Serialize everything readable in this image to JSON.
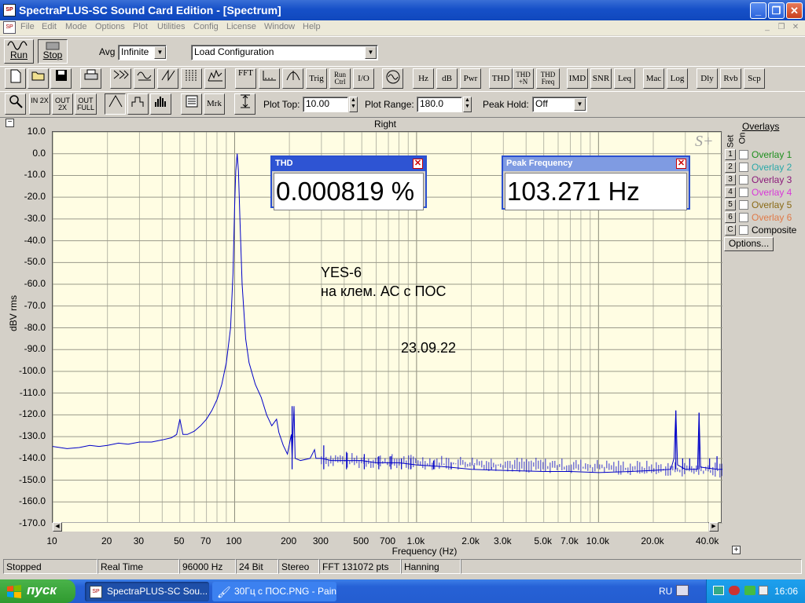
{
  "window": {
    "title": "SpectraPLUS-SC Sound Card Edition - [Spectrum]",
    "app_icon": "spectraplus-icon"
  },
  "menu": [
    "File",
    "Edit",
    "Mode",
    "Options",
    "Plot",
    "Utilities",
    "Config",
    "License",
    "Window",
    "Help"
  ],
  "toolbar1": {
    "run_label": "Run",
    "stop_label": "Stop",
    "avg_label": "Avg",
    "avg_value": "Infinite",
    "config_value": "Load Configuration"
  },
  "toolbar2": {
    "icon_buttons": [
      "new-file-icon",
      "open-folder-icon",
      "save-disk-icon",
      "print-icon"
    ],
    "buttons": [
      "FFT",
      "Trig",
      "Run Ctrl",
      "I/O",
      "Hz",
      "dB",
      "Pwr",
      "THD",
      "THD +N",
      "THD Freq",
      "IMD",
      "SNR",
      "Leq",
      "Mac",
      "Log",
      "Dly",
      "Rvb",
      "Scp"
    ]
  },
  "toolbar3": {
    "zoom_buttons": [
      "IN 2X",
      "OUT 2X",
      "OUT FULL"
    ],
    "mrk_label": "Mrk",
    "plot_top_label": "Plot Top:",
    "plot_top_value": "10.00",
    "plot_range_label": "Plot Range:",
    "plot_range_value": "180.0",
    "peak_hold_label": "Peak Hold:",
    "peak_hold_value": "Off"
  },
  "plot": {
    "channel_title": "Right",
    "ylabel": "dBV rms",
    "xlabel": "Frequency (Hz)",
    "annotation_line1": "YES-6",
    "annotation_line2": "на клем. АС с ПОС",
    "annotation_date": "23.09.22",
    "trace_color": "#0000c8",
    "background_color": "#fffde3"
  },
  "chart_data": {
    "type": "line",
    "title": "Right",
    "xlabel": "Frequency (Hz)",
    "ylabel": "dBV rms",
    "x_scale": "log",
    "xlim": [
      10,
      48000
    ],
    "ylim": [
      -170,
      10
    ],
    "grid": true,
    "y_ticks": [
      "10.0",
      "0.0",
      "-10.0",
      "-20.0",
      "-30.0",
      "-40.0",
      "-50.0",
      "-60.0",
      "-70.0",
      "-80.0",
      "-90.0",
      "-100.0",
      "-110.0",
      "-120.0",
      "-130.0",
      "-140.0",
      "-150.0",
      "-160.0",
      "-170.0"
    ],
    "x_ticks": [
      {
        "v": 10,
        "t": "10"
      },
      {
        "v": 20,
        "t": "20"
      },
      {
        "v": 30,
        "t": "30"
      },
      {
        "v": 50,
        "t": "50"
      },
      {
        "v": 70,
        "t": "70"
      },
      {
        "v": 100,
        "t": "100"
      },
      {
        "v": 200,
        "t": "200"
      },
      {
        "v": 300,
        "t": "300"
      },
      {
        "v": 500,
        "t": "500"
      },
      {
        "v": 700,
        "t": "700"
      },
      {
        "v": 1000,
        "t": "1.0k"
      },
      {
        "v": 2000,
        "t": "2.0k"
      },
      {
        "v": 3000,
        "t": "3.0k"
      },
      {
        "v": 5000,
        "t": "5.0k"
      },
      {
        "v": 7000,
        "t": "7.0k"
      },
      {
        "v": 10000,
        "t": "10.0k"
      },
      {
        "v": 20000,
        "t": "20.0k"
      },
      {
        "v": 40000,
        "t": "40.0k"
      }
    ],
    "series": [
      {
        "color": "#0000c8",
        "points": [
          [
            10,
            -134.5
          ],
          [
            12,
            -135.5
          ],
          [
            14,
            -135
          ],
          [
            16,
            -134
          ],
          [
            18,
            -134.5
          ],
          [
            20,
            -134
          ],
          [
            23,
            -133
          ],
          [
            26,
            -133.5
          ],
          [
            30,
            -132.5
          ],
          [
            35,
            -132.5
          ],
          [
            40,
            -131.5
          ],
          [
            45,
            -130.5
          ],
          [
            48,
            -129
          ],
          [
            50,
            -122
          ],
          [
            52,
            -129
          ],
          [
            55,
            -129
          ],
          [
            60,
            -127.5
          ],
          [
            65,
            -125
          ],
          [
            70,
            -122
          ],
          [
            75,
            -118
          ],
          [
            80,
            -113
          ],
          [
            85,
            -106
          ],
          [
            90,
            -96
          ],
          [
            95,
            -80
          ],
          [
            98,
            -55
          ],
          [
            100,
            -25
          ],
          [
            101.5,
            -8
          ],
          [
            103.27,
            0
          ],
          [
            105,
            -8
          ],
          [
            107,
            -30
          ],
          [
            110,
            -60
          ],
          [
            115,
            -85
          ],
          [
            120,
            -96
          ],
          [
            130,
            -106
          ],
          [
            140,
            -112
          ],
          [
            150,
            -120
          ],
          [
            160,
            -125
          ],
          [
            170,
            -122
          ],
          [
            175,
            -128
          ],
          [
            185,
            -134
          ],
          [
            195,
            -138
          ],
          [
            205,
            -129
          ],
          [
            207,
            -140
          ],
          [
            212,
            -116
          ],
          [
            215,
            -140
          ],
          [
            230,
            -141
          ],
          [
            260,
            -140
          ],
          [
            275,
            -136
          ],
          [
            280,
            -140
          ],
          [
            300,
            -140
          ],
          [
            340,
            -141
          ],
          [
            400,
            -141
          ],
          [
            500,
            -141
          ],
          [
            600,
            -142
          ],
          [
            800,
            -142
          ],
          [
            1000,
            -143
          ],
          [
            1500,
            -144
          ],
          [
            2000,
            -145
          ],
          [
            3000,
            -145.5
          ],
          [
            5000,
            -146
          ],
          [
            7000,
            -146
          ],
          [
            10000,
            -146.5
          ],
          [
            15000,
            -146
          ],
          [
            20000,
            -145.5
          ],
          [
            25000,
            -145
          ],
          [
            26000,
            -140
          ],
          [
            26600,
            -118
          ],
          [
            27200,
            -143
          ],
          [
            30000,
            -145
          ],
          [
            35000,
            -145
          ],
          [
            35700,
            -119
          ],
          [
            36400,
            -144
          ],
          [
            40000,
            -144.5
          ],
          [
            45000,
            -145
          ],
          [
            48000,
            -145
          ]
        ]
      }
    ],
    "spikes": [
      [
        207,
        -116
      ],
      [
        309,
        -134
      ],
      [
        412,
        -137
      ],
      [
        516,
        -138
      ],
      [
        620,
        -139
      ],
      [
        723,
        -139
      ],
      [
        826,
        -140
      ],
      [
        930,
        -140
      ],
      [
        1240,
        -141
      ],
      [
        1550,
        -142
      ],
      [
        2070,
        -143
      ],
      [
        2580,
        -144
      ],
      [
        26600,
        -118
      ],
      [
        29000,
        -140
      ],
      [
        31700,
        -140
      ],
      [
        35700,
        -119
      ],
      [
        40800,
        -140
      ],
      [
        44800,
        -139
      ]
    ]
  },
  "meters": {
    "thd": {
      "title": "THD",
      "value": "0.000819 %"
    },
    "peak": {
      "title": "Peak Frequency",
      "value": "103.271 Hz"
    }
  },
  "overlays": {
    "header": "Overlays",
    "col_set": "Set",
    "col_on": "On",
    "items": [
      {
        "num": "1",
        "label": "Overlay 1",
        "color": "#1e8f1e"
      },
      {
        "num": "2",
        "label": "Overlay 2",
        "color": "#2aa8a8"
      },
      {
        "num": "3",
        "label": "Overlay 3",
        "color": "#8b1a7a"
      },
      {
        "num": "4",
        "label": "Overlay 4",
        "color": "#d838d8"
      },
      {
        "num": "5",
        "label": "Overlay 5",
        "color": "#8a6a16"
      },
      {
        "num": "6",
        "label": "Overlay 6",
        "color": "#e07a48"
      },
      {
        "num": "C",
        "label": "Composite",
        "color": "#000000"
      }
    ],
    "options_label": "Options..."
  },
  "status": [
    "Stopped",
    "Real Time",
    "96000 Hz",
    "24 Bit",
    "Stereo",
    "FFT 131072 pts",
    "Hanning"
  ],
  "taskbar": {
    "start_label": "пуск",
    "tasks": [
      "SpectraPLUS-SC Sou...",
      "30Гц с ПОС.PNG - Paint"
    ],
    "lang": "RU",
    "clock": "16:06"
  }
}
